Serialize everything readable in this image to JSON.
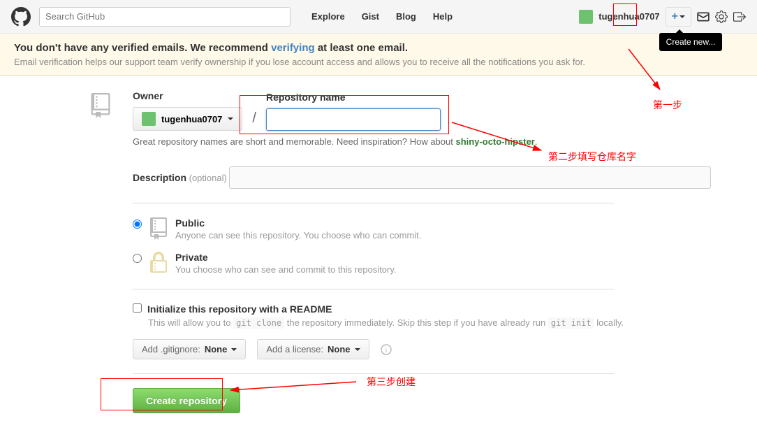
{
  "header": {
    "search_placeholder": "Search GitHub",
    "nav": [
      "Explore",
      "Gist",
      "Blog",
      "Help"
    ],
    "username": "tugenhua0707",
    "tooltip": "Create new..."
  },
  "notice": {
    "prefix": "You don't have any verified emails. We recommend ",
    "link": "verifying",
    "suffix": " at least one email.",
    "sub": "Email verification helps our support team verify ownership if you lose account access and allows you to receive all the notifications you ask for."
  },
  "form": {
    "owner_label": "Owner",
    "owner_value": "tugenhua0707",
    "repo_label": "Repository name",
    "hint_prefix": "Great repository names are short and memorable. Need inspiration? How about ",
    "hint_suggestion": "shiny-octo-hipster",
    "hint_suffix": ".",
    "desc_label": "Description",
    "desc_optional": " (optional)",
    "visibility": {
      "public": {
        "title": "Public",
        "desc": "Anyone can see this repository. You choose who can commit."
      },
      "private": {
        "title": "Private",
        "desc": "You choose who can see and commit to this repository."
      }
    },
    "readme": {
      "label": "Initialize this repository with a README",
      "desc_prefix": "This will allow you to ",
      "code1": "git clone",
      "desc_mid": " the repository immediately. Skip this step if you have already run ",
      "code2": "git init",
      "desc_suffix": " locally."
    },
    "gitignore": {
      "prefix": "Add .gitignore: ",
      "value": "None"
    },
    "license": {
      "prefix": "Add a license: ",
      "value": "None"
    },
    "submit": "Create repository"
  },
  "annotations": {
    "step1": "第一步",
    "step2": "第二步填写仓库名字",
    "step3": "第三步创建"
  }
}
